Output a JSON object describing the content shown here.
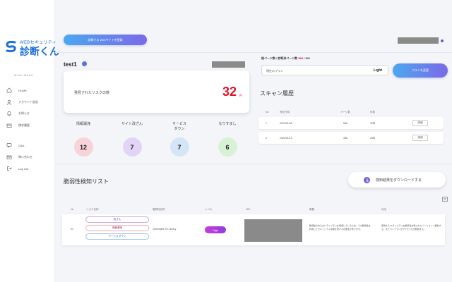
{
  "logo": {
    "sub": "WEBセキュリティ",
    "main": "診断くん"
  },
  "sidebar": {
    "title": "MAIN MENU",
    "items": [
      {
        "label": "HOME",
        "icon": "home-icon"
      },
      {
        "label": "アカウント設定",
        "icon": "user-icon"
      },
      {
        "label": "お知らせ",
        "icon": "bell-icon"
      },
      {
        "label": "請求履歴",
        "icon": "receipt-icon"
      },
      {
        "label": "Q&A",
        "icon": "chat-icon"
      },
      {
        "label": "問い合わせ",
        "icon": "mail-icon"
      },
      {
        "label": "Log Out",
        "icon": "logout-icon"
      }
    ]
  },
  "header": {
    "scan_button": "診断する Webサイトを登録"
  },
  "project": {
    "name": "test1"
  },
  "risk": {
    "label": "発見されたリスクの数",
    "count": "32",
    "unit": "件"
  },
  "categories": [
    {
      "label": "情報漏洩",
      "value": "12",
      "color": "#f8d3d9"
    },
    {
      "label": "サイト改ざん",
      "value": "7",
      "color": "#e2d4f6"
    },
    {
      "label": "サービス\nダウン",
      "value": "7",
      "color": "#d3e5f7"
    },
    {
      "label": "なりすまし",
      "value": "6",
      "color": "#d8f2d6"
    }
  ],
  "pages": {
    "label": "総ページ数 / 診断済ページ数",
    "used": "568",
    "total": "/ 500"
  },
  "plan": {
    "label": "現在のプラン",
    "value": "Light",
    "button": "プランを変更"
  },
  "scan_history": {
    "title": "スキャン履歴",
    "headers": [
      "No",
      "有効日時",
      "ページ数",
      "件数"
    ],
    "rows": [
      {
        "no": "1",
        "date": "2022/01/28",
        "pages": "568",
        "count": "32件",
        "button": "詳細"
      },
      {
        "no": "2",
        "date": "2022/01/19",
        "pages": "458",
        "count": "26件",
        "button": "詳細"
      }
    ]
  },
  "vulnerabilities": {
    "title": "脆弱性検知リスト",
    "download": "検知結果をダウンロードする",
    "headers": [
      "No",
      "リスク名称",
      "脆弱性名称",
      "レベル",
      "URL",
      "概要",
      "対応"
    ],
    "rows": [
      {
        "no": "01",
        "tags": [
          "改ざん",
          "情報漏洩",
          "サービスダウン"
        ],
        "target": "Vulnerable JS Library",
        "level": "High",
        "summary": "脆弱性のある古いライブラリを使用しているため、その脆弱性を利用したセキュリティ攻撃を受ける可能性があります。",
        "action": "使用するJSライブラリを脆弱性対策されたバージョンへ更新する、またライブラリのアクセス元を制限する。"
      }
    ]
  }
}
